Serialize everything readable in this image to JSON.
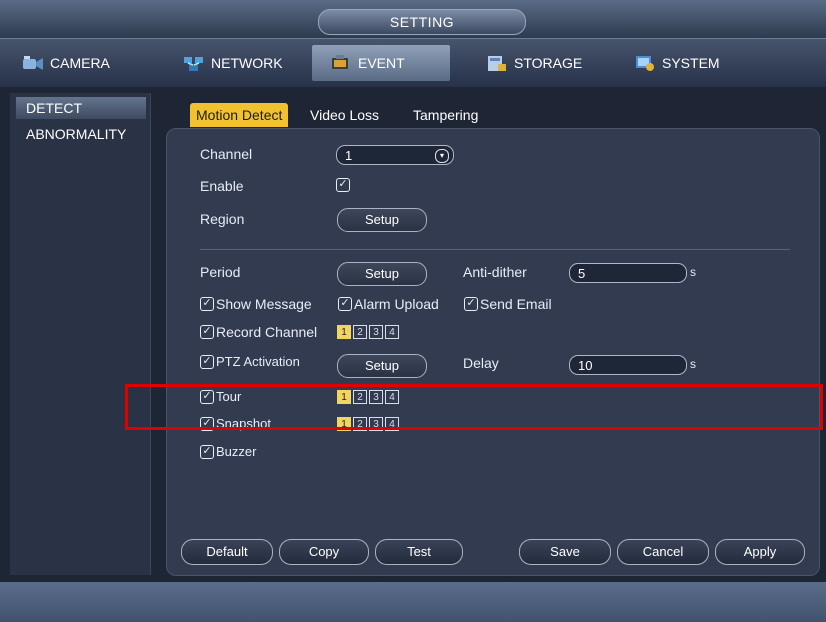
{
  "title": "SETTING",
  "main_tabs": [
    {
      "label": "CAMERA",
      "icon": "camera-icon"
    },
    {
      "label": "NETWORK",
      "icon": "network-icon"
    },
    {
      "label": "EVENT",
      "icon": "event-icon"
    },
    {
      "label": "STORAGE",
      "icon": "storage-icon"
    },
    {
      "label": "SYSTEM",
      "icon": "system-icon"
    }
  ],
  "sidebar": {
    "items": [
      {
        "label": "DETECT"
      },
      {
        "label": "ABNORMALITY"
      }
    ]
  },
  "sub_tabs": [
    {
      "label": "Motion Detect"
    },
    {
      "label": "Video Loss"
    },
    {
      "label": "Tampering"
    }
  ],
  "form": {
    "channel_label": "Channel",
    "channel_value": "1",
    "enable_label": "Enable",
    "region_label": "Region",
    "region_button": "Setup",
    "period_label": "Period",
    "period_button": "Setup",
    "anti_dither_label": "Anti-dither",
    "anti_dither_value": "5",
    "anti_dither_unit": "s",
    "show_message": "Show Message",
    "alarm_upload": "Alarm Upload",
    "send_email": "Send Email",
    "record_channel": "Record Channel",
    "ptz_activation": "PTZ Activation",
    "ptz_button": "Setup",
    "delay_label": "Delay",
    "delay_value": "10",
    "delay_unit": "s",
    "tour_label": "Tour",
    "snapshot_label": "Snapshot",
    "buzzer_label": "Buzzer",
    "channels": [
      "1",
      "2",
      "3",
      "4"
    ]
  },
  "buttons": {
    "default": "Default",
    "copy": "Copy",
    "test": "Test",
    "save": "Save",
    "cancel": "Cancel",
    "apply": "Apply"
  },
  "colors": {
    "accent": "#f2c22e",
    "highlight": "#e00000"
  }
}
